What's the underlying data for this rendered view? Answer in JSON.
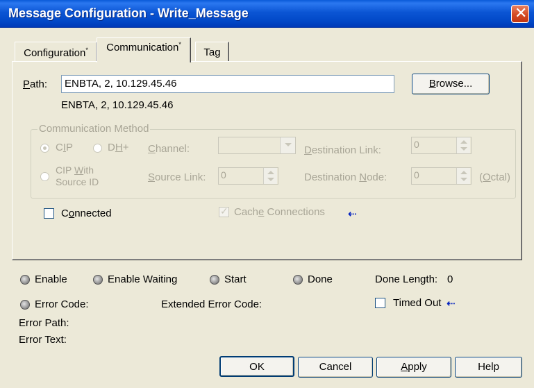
{
  "window": {
    "title": "Message Configuration - Write_Message",
    "close_glyph": "✕"
  },
  "tabs": [
    {
      "label": "Configuration",
      "marker": "*"
    },
    {
      "label": "Communication",
      "marker": "*"
    },
    {
      "label": "Tag",
      "marker": ""
    }
  ],
  "path": {
    "label_u": "P",
    "label_rest": "ath:",
    "value": "ENBTA, 2, 10.129.45.46",
    "resolved": "ENBTA, 2, 10.129.45.46",
    "browse_u": "B",
    "browse_rest": "rowse..."
  },
  "comm_method": {
    "legend": "Communication Method",
    "cip_pre": "C",
    "cip_u": "I",
    "cip_post": "P",
    "cip_selected": true,
    "dh_pre": "D",
    "dh_u": "H",
    "dh_post": "+",
    "cip_with_line1_pre": "CIP ",
    "cip_with_line1_u": "W",
    "cip_with_line1_post": "ith",
    "cip_with_line2": "Source ID",
    "channel_u": "C",
    "channel_rest": "hannel:",
    "channel_value": "",
    "source_link_u": "S",
    "source_link_rest": "ource Link:",
    "source_link_value": "0",
    "dest_link_u": "D",
    "dest_link_rest": "estination Link:",
    "dest_link_value": "0",
    "dest_node_pre": "Destination ",
    "dest_node_u": "N",
    "dest_node_rest": "ode:",
    "dest_node_value": "0",
    "octal_pre": "(",
    "octal_u": "O",
    "octal_rest": "ctal)"
  },
  "connected": {
    "label_pre": "C",
    "label_u": "o",
    "label_rest": "nnected",
    "checked": false
  },
  "cache": {
    "label_pre": "Cach",
    "label_u": "e",
    "label_rest": " Connections",
    "checked": true,
    "arrow": "⇠"
  },
  "status": {
    "enable": "Enable",
    "enable_waiting": "Enable Waiting",
    "start": "Start",
    "done": "Done",
    "done_length_label": "Done Length:",
    "done_length_value": "0",
    "error_code": "Error Code:",
    "extended_error_code": "Extended Error Code:",
    "timed_out": "Timed Out",
    "timed_out_arrow": "⇠",
    "error_path": "Error Path:",
    "error_text": "Error Text:"
  },
  "buttons": {
    "ok": "OK",
    "cancel": "Cancel",
    "apply_u": "A",
    "apply_rest": "pply",
    "help": "Help"
  }
}
